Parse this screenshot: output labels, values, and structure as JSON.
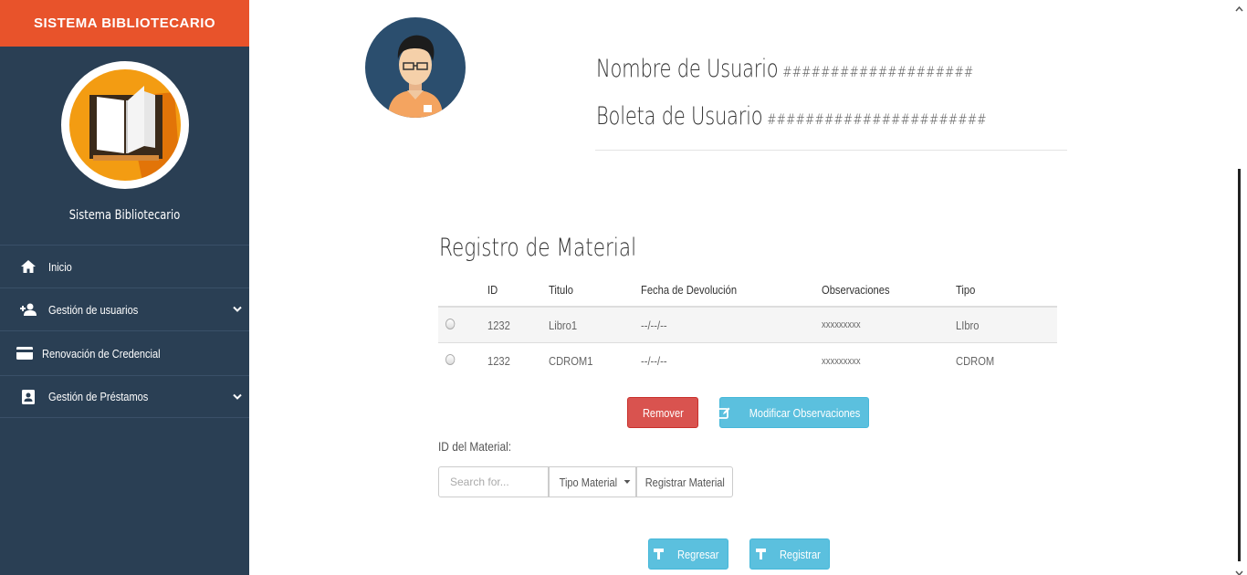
{
  "sidebar": {
    "brand": "SISTEMA BIBLIOTECARIO",
    "system_name": "Sistema Bibliotecario",
    "items": [
      {
        "label": "Inicio",
        "icon": "home-icon"
      },
      {
        "label": "Gestión de usuarios",
        "icon": "add-user-icon"
      },
      {
        "label": "Renovación de Credencial",
        "icon": "credit-card-icon"
      },
      {
        "label": "Gestión de Préstamos",
        "icon": "contact-card-icon"
      }
    ]
  },
  "user": {
    "name_label": "Nombre de Usuario",
    "name_value": "####################",
    "id_label": "Boleta de Usuario",
    "id_value": "#######################"
  },
  "materials": {
    "title": "Registro de Material",
    "columns": [
      "ID",
      "Titulo",
      "Fecha de Devolución",
      "Observaciones",
      "Tipo"
    ],
    "rows": [
      {
        "id": "1232",
        "title": "Libro1",
        "date": "--/--/--",
        "obs": "xxxxxxxxx",
        "type": "LIbro"
      },
      {
        "id": "1232",
        "title": "CDROM1",
        "date": "--/--/--",
        "obs": "xxxxxxxxx",
        "type": "CDROM"
      }
    ],
    "remove_label": "Remover",
    "modify_label": "Modificar Observaciones"
  },
  "register": {
    "id_label": "ID del Material:",
    "search_placeholder": "Search for...",
    "type_label": "Tipo Material",
    "register_material_label": "Registrar Material"
  },
  "footer": {
    "back_label": "Regresar",
    "register_label": "Registrar"
  },
  "colors": {
    "brand": "#e8532b",
    "sidebar": "#2a3f54",
    "danger": "#d9534f",
    "info": "#5bc0de"
  }
}
